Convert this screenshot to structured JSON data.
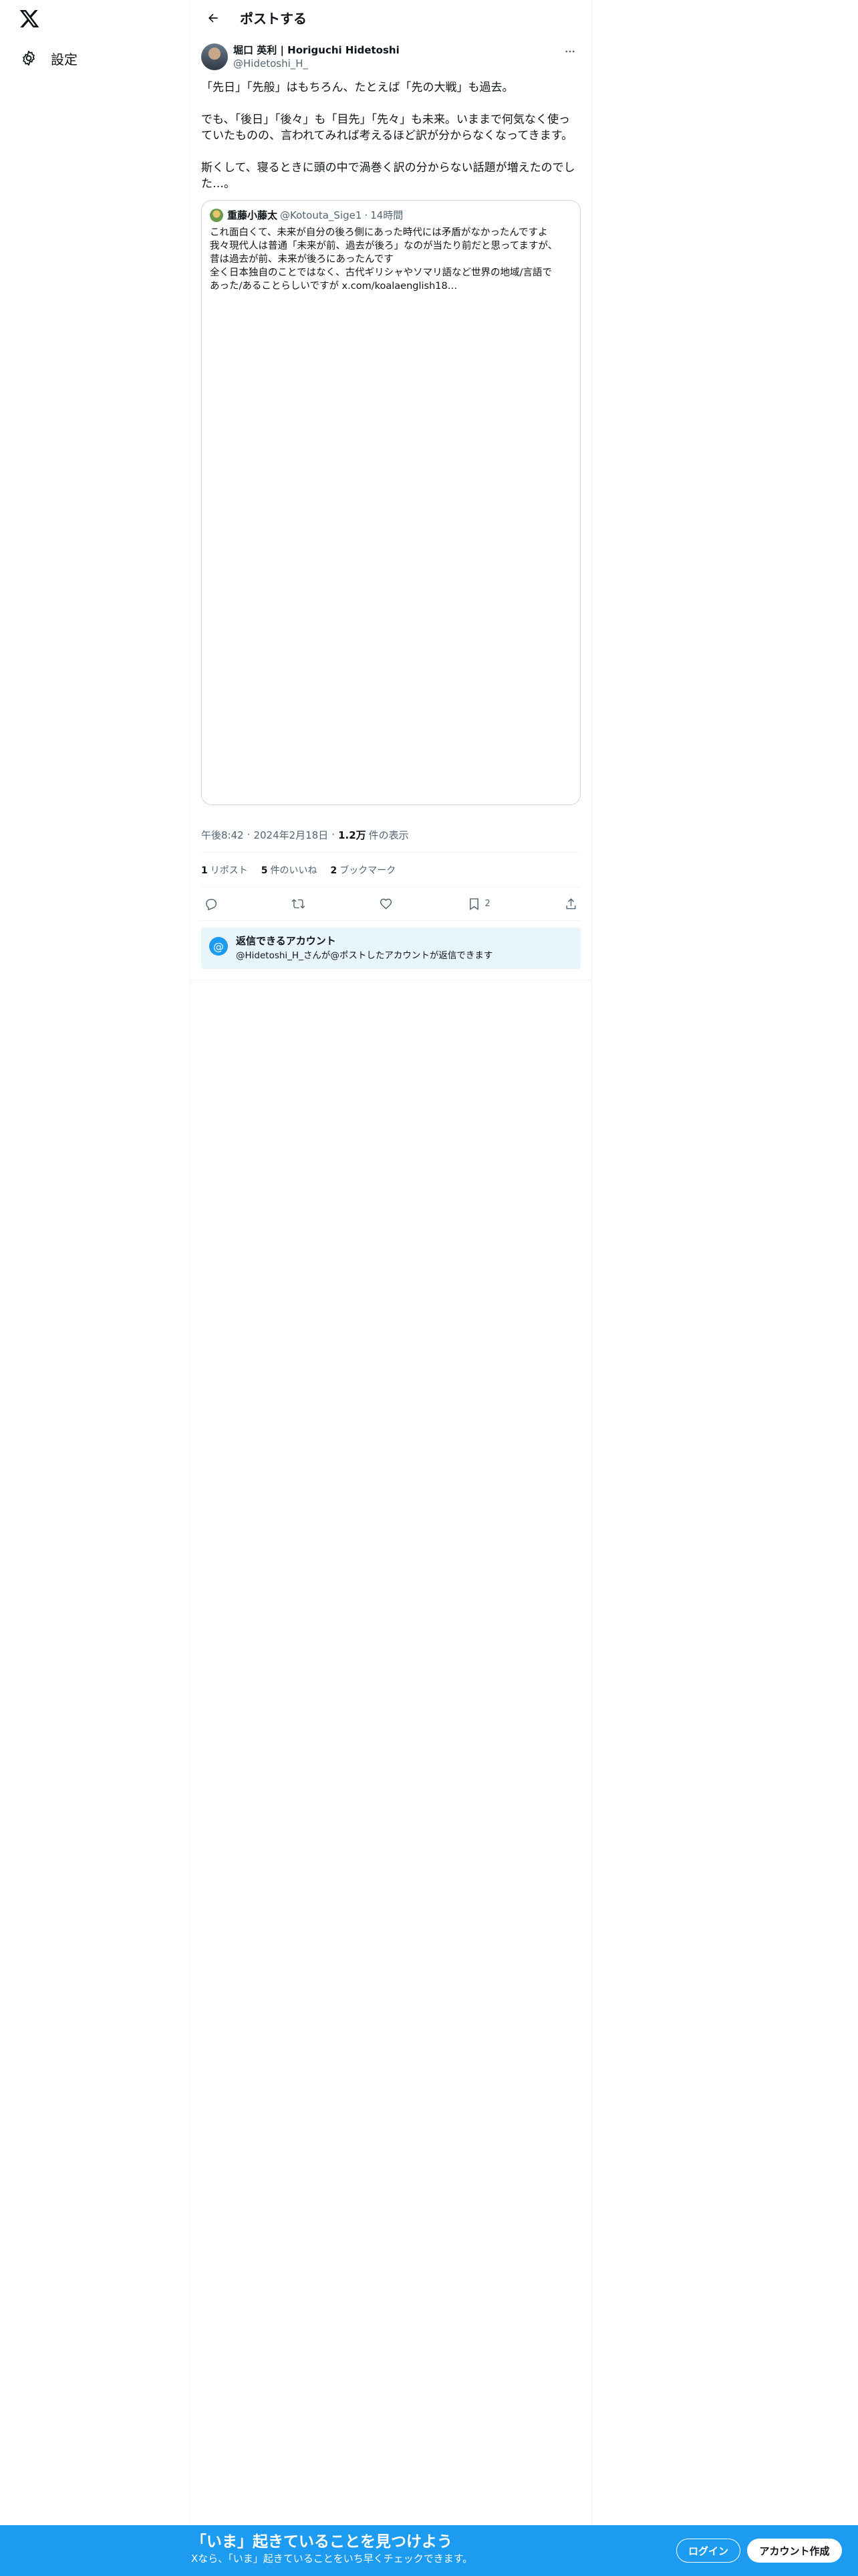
{
  "nav": {
    "logo_icon": "x-logo-icon",
    "settings_label": "設定"
  },
  "header": {
    "title": "ポストする"
  },
  "tweet": {
    "author_name": "堀口 英利 | Horiguchi Hidetoshi",
    "author_handle": "@Hidetoshi_H_",
    "paragraphs": [
      "「先日」「先般」はもちろん、たとえば「先の大戦」も過去。",
      "でも、「後日」「後々」も「目先」「先々」も未来。いままで何気なく使っていたものの、言われてみれば考えるほど訳が分からなくなってきます。",
      "斯くして、寝るときに頭の中で渦巻く訳の分からない話題が増えたのでした…。"
    ],
    "quote": {
      "name": "重藤小藤太",
      "handle": "@Kotouta_Sige1",
      "time": "14時間",
      "lines": [
        "これ面白くて、未来が自分の後ろ側にあった時代には矛盾がなかったんですよ",
        "我々現代人は普通「未来が前、過去が後ろ」なのが当たり前だと思ってますが、",
        "昔は過去が前、未来が後ろにあったんです",
        "全く日本独自のことではなく、古代ギリシャやソマリ語など世界の地域/言語で",
        "あった/あることらしいですが x.com/koalaenglish18…"
      ]
    },
    "time": "午後8:42",
    "date": "2024年2月18日",
    "views_count": "1.2万",
    "views_label": "件の表示",
    "reposts_count": "1",
    "reposts_label": "リポスト",
    "likes_count": "5",
    "likes_label": "件のいいね",
    "bookmarks_count": "2",
    "bookmarks_label": "ブックマーク",
    "bookmark_action_count": "2"
  },
  "reply_notice": {
    "icon": "at-icon",
    "title": "返信できるアカウント",
    "text": "@Hidetoshi_H_さんが@ポストしたアカウントが返信できます"
  },
  "banner": {
    "title": "「いま」起きていることを見つけよう",
    "subtitle": "Xなら、「いま」起きていることをいち早くチェックできます。",
    "login_label": "ログイン",
    "signup_label": "アカウント作成",
    "background": "#1d9bf0"
  }
}
